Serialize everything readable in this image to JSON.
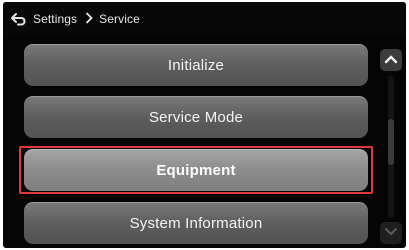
{
  "header": {
    "breadcrumb": [
      "Settings",
      "Service"
    ],
    "icons": {
      "back": "back-arrow-icon",
      "separator": "chevron-right-icon"
    }
  },
  "menu": {
    "items": [
      {
        "label": "Initialize",
        "selected": false
      },
      {
        "label": "Service Mode",
        "selected": false
      },
      {
        "label": "Equipment",
        "selected": true
      },
      {
        "label": "System Information",
        "selected": false
      }
    ]
  },
  "scroll": {
    "position_fraction": 0.45,
    "icons": {
      "up": "chevron-up-icon",
      "down": "chevron-down-icon"
    }
  },
  "colors": {
    "highlight": "#e03a3a",
    "button": "#5e5e5e",
    "selected_button": "#8c8c8c",
    "background": "#050505"
  }
}
